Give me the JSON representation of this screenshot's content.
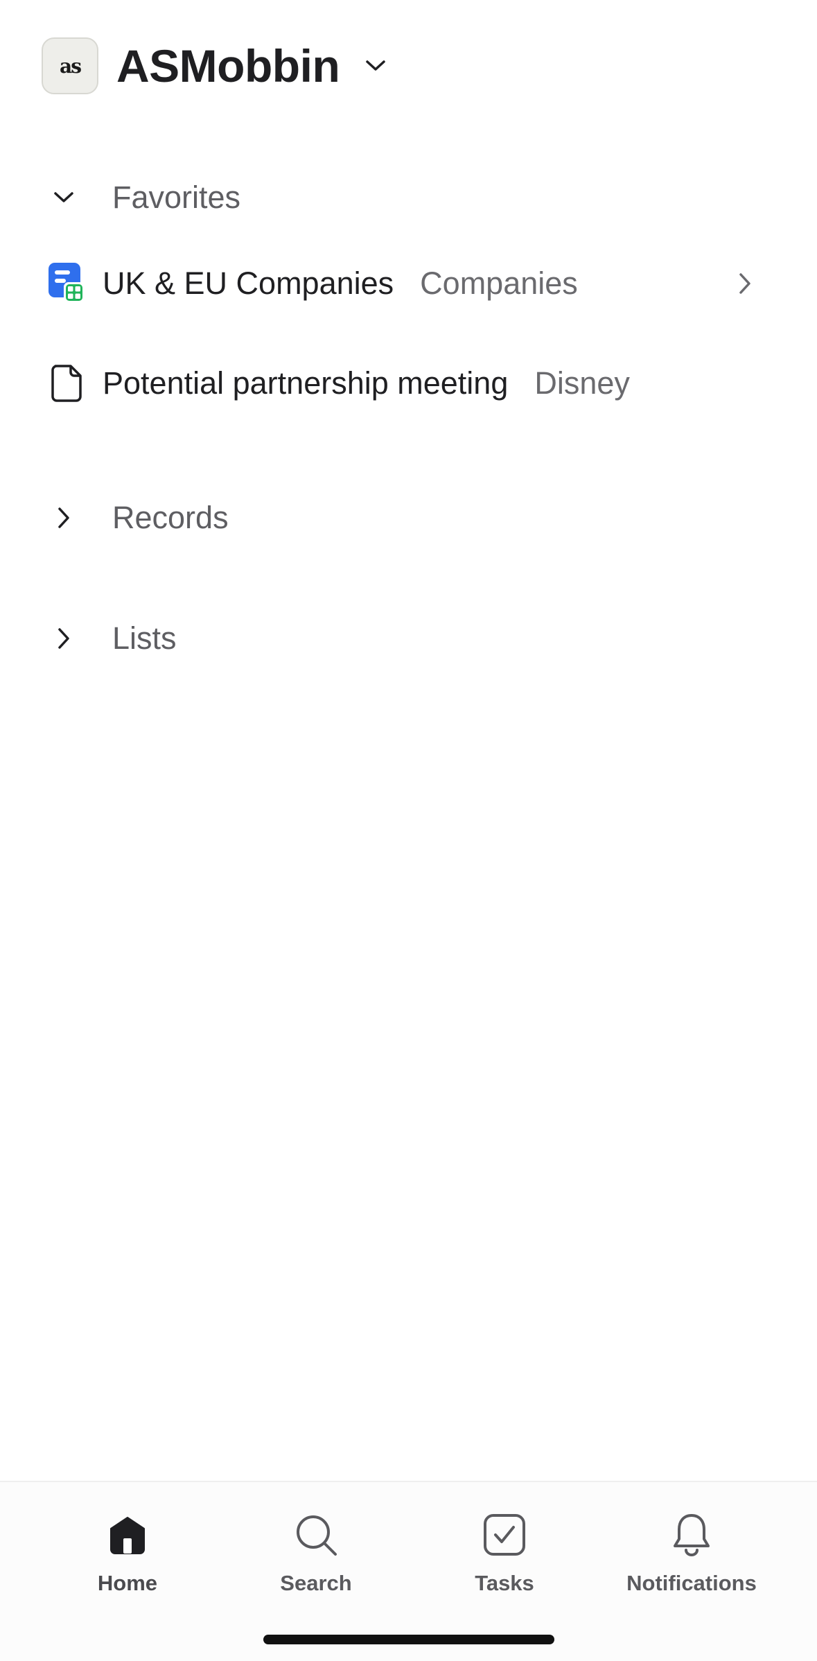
{
  "workspace": {
    "logo_text": "as",
    "name": "ASMobbin"
  },
  "sections": {
    "favorites": {
      "label": "Favorites",
      "expanded": true,
      "items": [
        {
          "title": "UK & EU Companies",
          "subtitle": "Companies",
          "icon": "list-companies-icon"
        },
        {
          "title": "Potential partnership meeting",
          "subtitle": "Disney",
          "icon": "document-icon"
        }
      ]
    },
    "records": {
      "label": "Records",
      "expanded": false
    },
    "lists": {
      "label": "Lists",
      "expanded": false
    }
  },
  "tabbar": {
    "tabs": [
      {
        "label": "Home",
        "icon": "home-icon",
        "active": true
      },
      {
        "label": "Search",
        "icon": "search-icon",
        "active": false
      },
      {
        "label": "Tasks",
        "icon": "tasks-icon",
        "active": false
      },
      {
        "label": "Notifications",
        "icon": "bell-icon",
        "active": false
      }
    ]
  },
  "colors": {
    "accent_blue": "#2f6fed",
    "accent_green": "#20b45a",
    "text_primary": "#1f1f22",
    "text_secondary": "#5e5e62"
  }
}
